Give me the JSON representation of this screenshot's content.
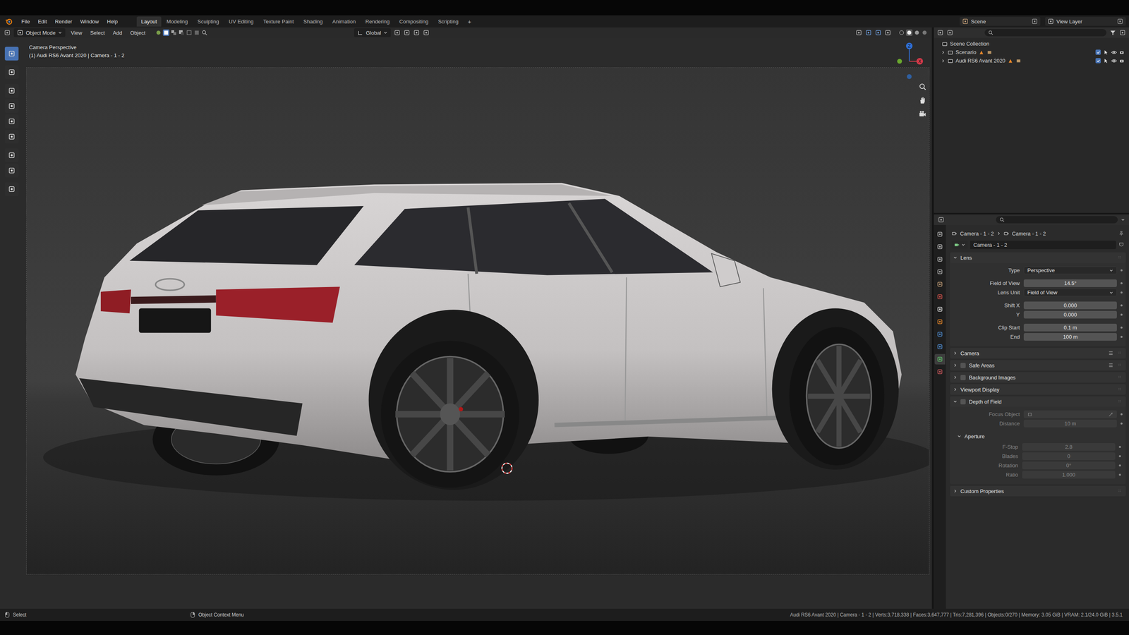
{
  "menubar": {
    "menus": [
      "File",
      "Edit",
      "Render",
      "Window",
      "Help"
    ],
    "workspaces": [
      {
        "label": "Layout",
        "selected": true
      },
      {
        "label": "Modeling",
        "selected": false
      },
      {
        "label": "Sculpting",
        "selected": false
      },
      {
        "label": "UV Editing",
        "selected": false
      },
      {
        "label": "Texture Paint",
        "selected": false
      },
      {
        "label": "Shading",
        "selected": false
      },
      {
        "label": "Animation",
        "selected": false
      },
      {
        "label": "Rendering",
        "selected": false
      },
      {
        "label": "Compositing",
        "selected": false
      },
      {
        "label": "Scripting",
        "selected": false
      }
    ],
    "add_workspace": "+",
    "scene": "Scene",
    "view_layer": "View Layer"
  },
  "viewport_header": {
    "mode": "Object Mode",
    "menus": [
      "View",
      "Select",
      "Add",
      "Object"
    ],
    "orientation": "Global"
  },
  "viewport": {
    "view_name": "Camera Perspective",
    "view_info": "(1) Audi RS6 Avant 2020 | Camera - 1 - 2",
    "gizmo": {
      "z": "Z",
      "x": "X"
    },
    "tools": [
      {
        "selected": true
      },
      {
        "selected": false
      },
      {
        "selected": false
      },
      {
        "selected": false
      },
      {
        "selected": false
      },
      {
        "selected": false
      },
      {
        "selected": false
      },
      {
        "selected": false
      },
      {
        "selected": false
      }
    ]
  },
  "outliner": {
    "root": "Scene Collection",
    "collections": [
      {
        "label": "Scenario",
        "expanded": false,
        "checked": true,
        "visible": true
      },
      {
        "label": "Audi RS6 Avant 2020",
        "expanded": false,
        "checked": true,
        "visible": true
      }
    ]
  },
  "properties": {
    "tabs": [
      {
        "color": "#b8b8b8",
        "selected": false
      },
      {
        "color": "#b8b8b8",
        "selected": false
      },
      {
        "color": "#b8b8b8",
        "selected": false
      },
      {
        "color": "#b8b8b8",
        "selected": false
      },
      {
        "color": "#c9a27a",
        "selected": false
      },
      {
        "color": "#d0504a",
        "selected": false
      },
      {
        "color": "#d8d8d8",
        "selected": false
      },
      {
        "color": "#e8882a",
        "selected": false
      },
      {
        "color": "#4f8fd6",
        "selected": false
      },
      {
        "color": "#4f8fd6",
        "selected": false
      },
      {
        "color": "#5fbf6a",
        "selected": true
      },
      {
        "color": "#c8555a",
        "selected": false
      }
    ],
    "breadcrumb": [
      "Camera - 1 - 2",
      "Camera - 1 - 2"
    ],
    "datablock": "Camera - 1 - 2",
    "panels": [
      {
        "title": "Lens",
        "expanded": true,
        "has_checkbox": false,
        "checked": false,
        "presets": false,
        "groups": [
          [
            {
              "label": "Type",
              "value": "Perspective",
              "kind": "dropdown",
              "disabled": false
            }
          ],
          [
            {
              "label": "Field of View",
              "value": "14.5°",
              "kind": "number",
              "disabled": false
            },
            {
              "label": "Lens Unit",
              "value": "Field of View",
              "kind": "dropdown",
              "disabled": false
            }
          ],
          [
            {
              "label": "Shift X",
              "value": "0.000",
              "kind": "number",
              "disabled": false
            },
            {
              "label": "Y",
              "value": "0.000",
              "kind": "number",
              "disabled": false
            }
          ],
          [
            {
              "label": "Clip Start",
              "value": "0.1 m",
              "kind": "number",
              "disabled": false
            },
            {
              "label": "End",
              "value": "100 m",
              "kind": "number",
              "disabled": false
            }
          ]
        ],
        "subpanels": []
      },
      {
        "title": "Camera",
        "expanded": false,
        "has_checkbox": false,
        "checked": false,
        "presets": true,
        "groups": [],
        "subpanels": []
      },
      {
        "title": "Safe Areas",
        "expanded": false,
        "has_checkbox": true,
        "checked": false,
        "presets": true,
        "groups": [],
        "subpanels": []
      },
      {
        "title": "Background Images",
        "expanded": false,
        "has_checkbox": true,
        "checked": false,
        "presets": false,
        "groups": [],
        "subpanels": []
      },
      {
        "title": "Viewport Display",
        "expanded": false,
        "has_checkbox": false,
        "checked": false,
        "presets": false,
        "groups": [],
        "subpanels": []
      },
      {
        "title": "Depth of Field",
        "expanded": true,
        "has_checkbox": true,
        "checked": false,
        "presets": false,
        "groups": [
          [
            {
              "label": "Focus Object",
              "value": "",
              "kind": "object",
              "disabled": true
            },
            {
              "label": "Distance",
              "value": "10 m",
              "kind": "number",
              "disabled": true
            }
          ]
        ],
        "subpanels": [
          {
            "title": "Aperture",
            "expanded": true,
            "groups": [
              [
                {
                  "label": "F-Stop",
                  "value": "2.8",
                  "kind": "number",
                  "disabled": true
                },
                {
                  "label": "Blades",
                  "value": "0",
                  "kind": "number",
                  "disabled": true
                },
                {
                  "label": "Rotation",
                  "value": "0°",
                  "kind": "number",
                  "disabled": true
                },
                {
                  "label": "Ratio",
                  "value": "1.000",
                  "kind": "number",
                  "disabled": true
                }
              ]
            ]
          }
        ]
      },
      {
        "title": "Custom Properties",
        "expanded": false,
        "has_checkbox": false,
        "checked": false,
        "presets": false,
        "groups": [],
        "subpanels": []
      }
    ]
  },
  "status_bar": {
    "hints": [
      "Select",
      "Object Context Menu"
    ],
    "stats": "Audi RS6 Avant 2020 | Camera - 1 - 2 | Verts:3,718,338 | Faces:3,647,777 | Tris:7,281,396 | Objects:0/270 | Memory: 3.05 GiB | VRAM: 2.1/24.0 GiB | 3.5.1"
  }
}
